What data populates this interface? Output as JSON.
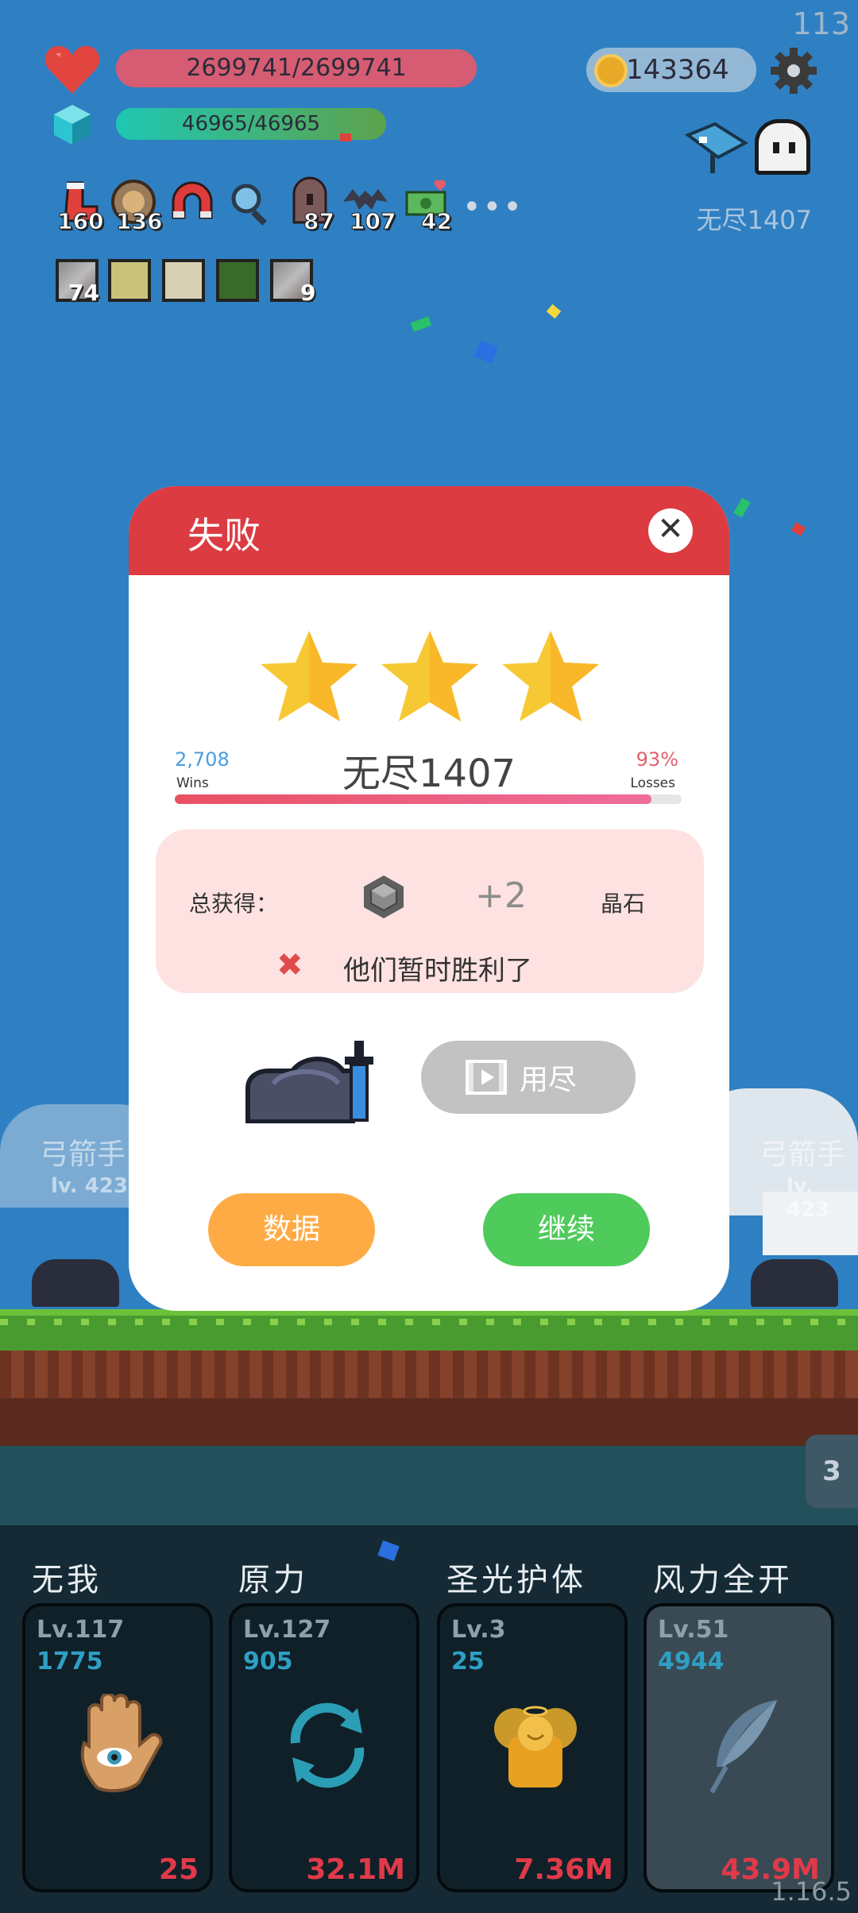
{
  "hud": {
    "fps": "113",
    "hp": "2699741/2699741",
    "mp": "46965/46965",
    "coins": "143364",
    "stage_label": "无尽1407"
  },
  "items": [
    {
      "name": "boot",
      "count": "160"
    },
    {
      "name": "shield",
      "count": "136"
    },
    {
      "name": "magnet",
      "count": ""
    },
    {
      "name": "magnifier",
      "count": ""
    },
    {
      "name": "door",
      "count": "87"
    },
    {
      "name": "bat",
      "count": "107"
    },
    {
      "name": "cash-heart",
      "count": "42"
    }
  ],
  "more_label": "•••",
  "badges": [
    {
      "name": "sword",
      "count": "74"
    },
    {
      "name": "lightbulb",
      "count": ""
    },
    {
      "name": "helmet",
      "count": ""
    },
    {
      "name": "runner",
      "count": ""
    },
    {
      "name": "sword2",
      "count": "9"
    }
  ],
  "dialog": {
    "title": "失败",
    "close": "✕",
    "stars": 3,
    "wins_value": "2,708",
    "wins_label": "Wins",
    "losses_value": "93%",
    "losses_label": "Losses",
    "stage_name": "无尽1407",
    "loss_ratio": 0.94,
    "total_label": "总获得：",
    "reward_amount": "+2",
    "reward_unit": "晶石",
    "result_message": "他们暂时胜利了",
    "video_label": "用尽",
    "data_button": "数据",
    "continue_button": "继续"
  },
  "enemies": {
    "left_name": "弓箭手",
    "left_level": "lv. 423",
    "right_name": "弓箭手",
    "right_level": "lv. 423"
  },
  "side_badge": "3",
  "skills": [
    {
      "name": "无我",
      "level": "Lv.117",
      "value": "1775",
      "cost": "25",
      "icon": "eye-hand-icon"
    },
    {
      "name": "原力",
      "level": "Lv.127",
      "value": "905",
      "cost": "32.1M",
      "icon": "refresh-icon"
    },
    {
      "name": "圣光护体",
      "level": "Lv.3",
      "value": "25",
      "cost": "7.36M",
      "icon": "angel-icon"
    },
    {
      "name": "风力全开",
      "level": "Lv.51",
      "value": "4944",
      "cost": "43.9M",
      "icon": "feather-icon"
    }
  ],
  "version": "1.16.5",
  "colors": {
    "header_red": "#dc3b42",
    "data_orange": "#ffab45",
    "continue_green": "#4fcb5b",
    "star_gold": "#f6c934"
  }
}
